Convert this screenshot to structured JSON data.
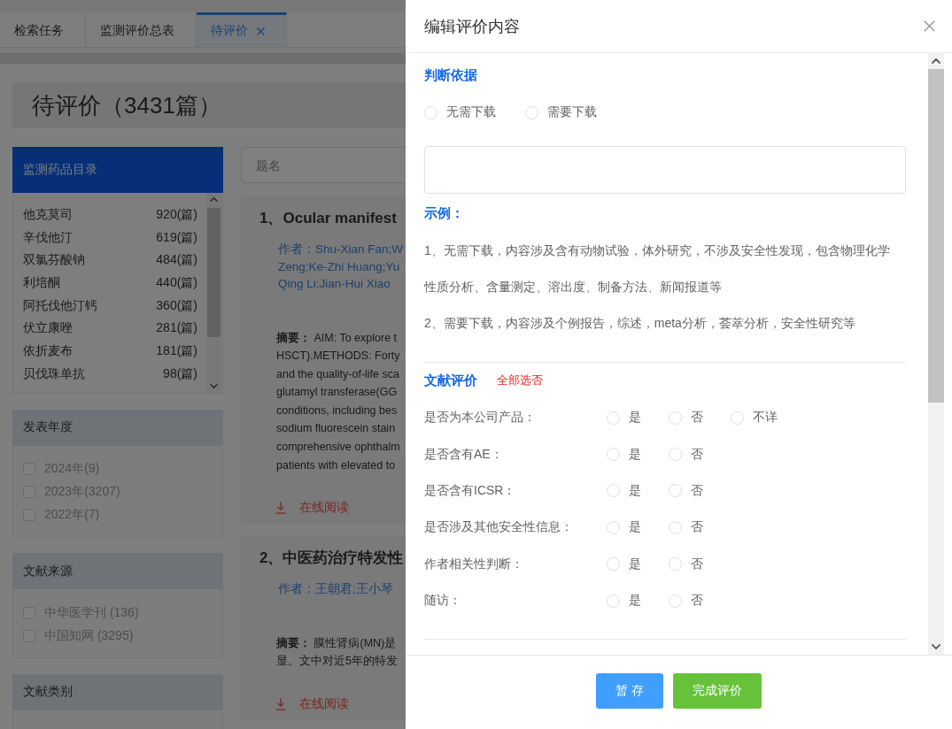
{
  "tabs": [
    {
      "label": "检索任务",
      "selected": false,
      "closable": false
    },
    {
      "label": "监测评价总表",
      "selected": false,
      "closable": false
    },
    {
      "label": "待评价",
      "selected": true,
      "closable": true
    }
  ],
  "page_title": "待评价（3431篇）",
  "sidebar": {
    "catalog": {
      "title": "监测药品目录",
      "items": [
        {
          "name": "他克莫司",
          "count": "920(篇)"
        },
        {
          "name": "辛伐他汀",
          "count": "619(篇)"
        },
        {
          "name": "双氯芬酸钠",
          "count": "484(篇)"
        },
        {
          "name": "利培酮",
          "count": "440(篇)"
        },
        {
          "name": "阿托伐他汀钙",
          "count": "360(篇)"
        },
        {
          "name": "伏立康唑",
          "count": "281(篇)"
        },
        {
          "name": "依折麦布",
          "count": "181(篇)"
        },
        {
          "name": "贝伐珠单抗",
          "count": "98(篇)"
        }
      ]
    },
    "filters": [
      {
        "title": "发表年度",
        "options": [
          {
            "label": "2024年(9)",
            "checked": false
          },
          {
            "label": "2023年(3207)",
            "checked": false
          },
          {
            "label": "2022年(7)",
            "checked": false
          }
        ]
      },
      {
        "title": "文献来源",
        "options": [
          {
            "label": "中华医学刊 (136)",
            "checked": false
          },
          {
            "label": "中国知网 (3295)",
            "checked": false
          }
        ]
      },
      {
        "title": "文献类别"
      }
    ]
  },
  "search": {
    "placeholder": "题名"
  },
  "articles": [
    {
      "title": "1、Ocular manifest",
      "authors": "作者：Shu-Xian Fan;W\nZeng;Ke-Zhi Huang;Yu\nQing Li;Jian-Hui Xiao",
      "abstract": [
        "**摘要：** AIM: To explore t",
        "HSCT).METHODS: Forty",
        "and the quality-of-life sca",
        "glutamyl transferase(GG",
        "conditions, including bes",
        "sodium fluorescein stain",
        "comprehensive ophthalm",
        "patients with elevated to"
      ],
      "link": "在线阅读"
    },
    {
      "title": "2、中医药治疗特发性",
      "authors": "作者：王朝君;王小琴",
      "abstract": [
        "**摘要：** 膜性肾病(MN)是",
        "显。文中对近5年的特发"
      ],
      "link": "在线阅读"
    }
  ],
  "drawer": {
    "title": "编辑评价内容",
    "basis": {
      "title": "判断依据",
      "options": [
        {
          "label": "无需下载",
          "selected": false
        },
        {
          "label": "需要下载",
          "selected": false
        }
      ]
    },
    "example": {
      "title": "示例：",
      "lines": [
        "1、无需下载，内容涉及含有动物试验，体外研究，不涉及安全性发现，包含物理化学性质分析、含量测定、溶出度、制备方法、新闻报道等",
        "2、需要下载，内容涉及个例报告，综述，meta分析，荟萃分析，安全性研究等"
      ]
    },
    "evaluation": {
      "title": "文献评价",
      "action": "全部选否",
      "questions": [
        {
          "label": "是否为本公司产品：",
          "options": [
            {
              "label": "是",
              "selected": false
            },
            {
              "label": "否",
              "selected": false
            },
            {
              "label": "不详",
              "selected": false
            }
          ]
        },
        {
          "label": "是否含有AE：",
          "options": [
            {
              "label": "是",
              "selected": false
            },
            {
              "label": "否",
              "selected": false
            }
          ]
        },
        {
          "label": "是否含有ICSR：",
          "options": [
            {
              "label": "是",
              "selected": false
            },
            {
              "label": "否",
              "selected": false
            }
          ]
        },
        {
          "label": "是否涉及其他安全性信息：",
          "options": [
            {
              "label": "是",
              "selected": false
            },
            {
              "label": "否",
              "selected": false
            }
          ]
        },
        {
          "label": "作者相关性判断：",
          "options": [
            {
              "label": "是",
              "selected": false
            },
            {
              "label": "否",
              "selected": false
            }
          ]
        },
        {
          "label": "随访：",
          "options": [
            {
              "label": "是",
              "selected": false
            },
            {
              "label": "否",
              "selected": false
            }
          ]
        }
      ]
    },
    "buttons": [
      {
        "label": "暂 存",
        "kind": "primary"
      },
      {
        "label": "完成评价",
        "kind": "success"
      }
    ]
  }
}
